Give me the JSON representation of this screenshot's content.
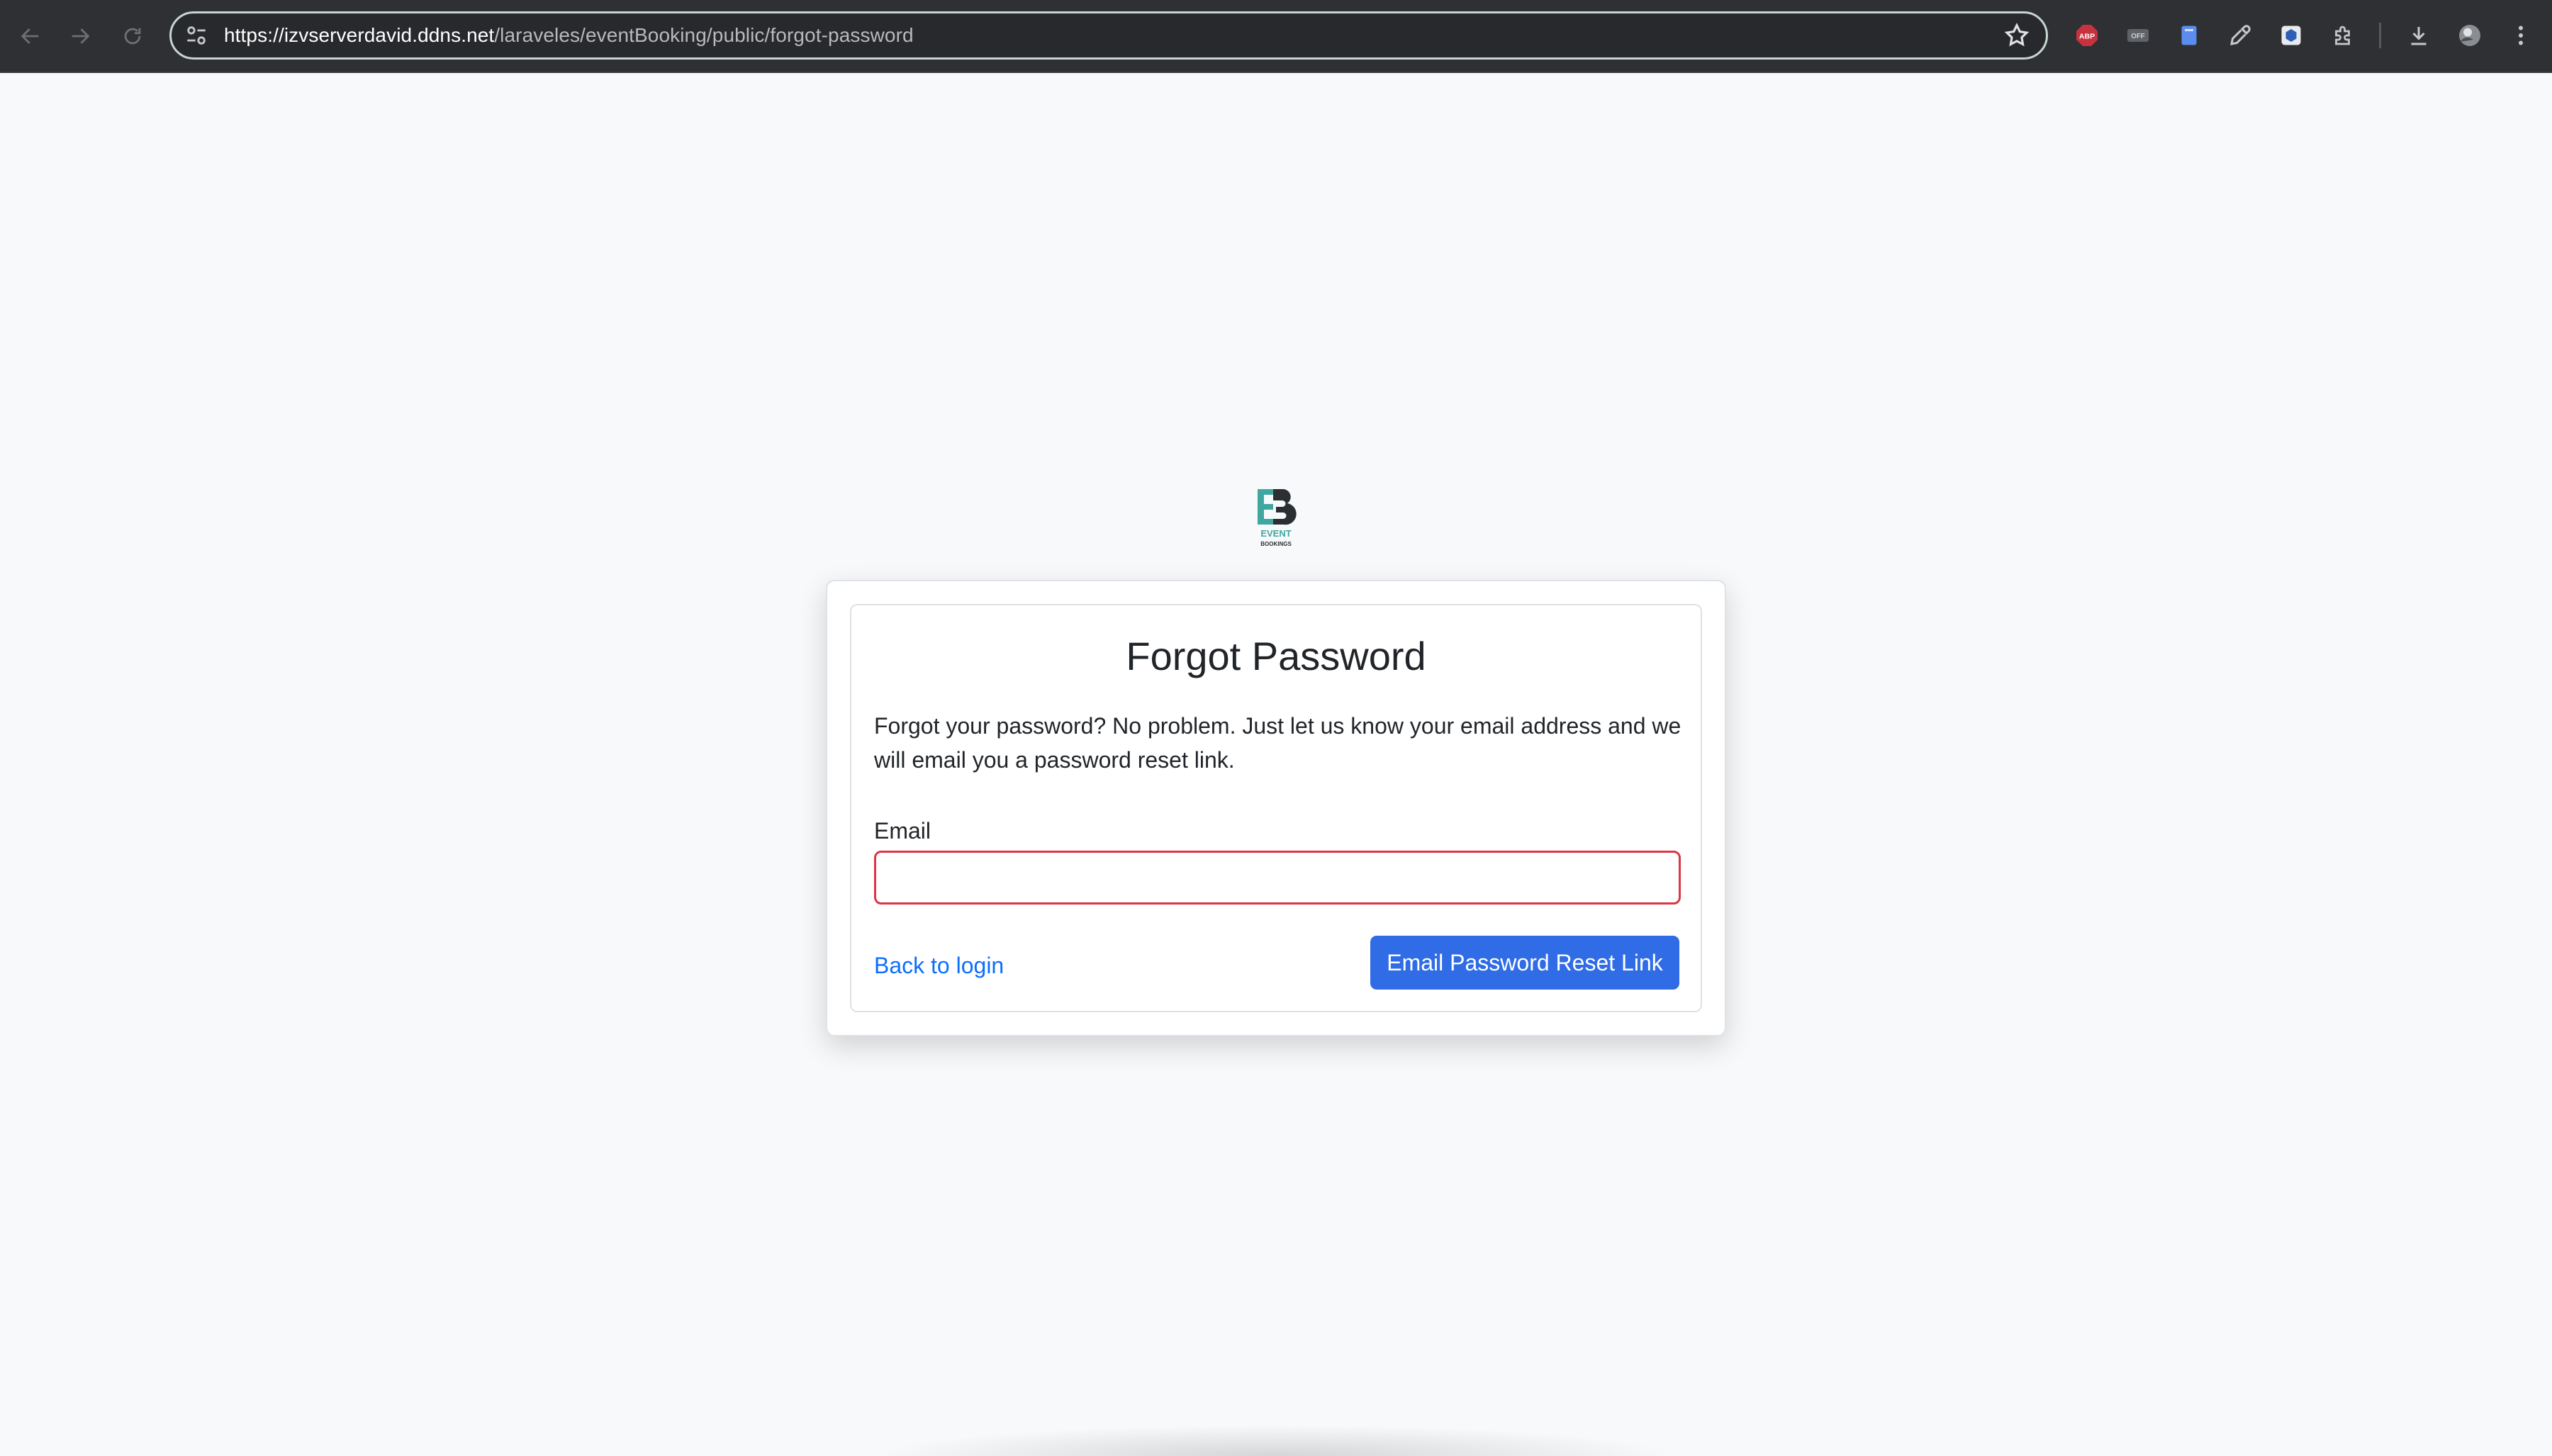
{
  "browser": {
    "url_host": "https://izvserverdavid.ddns.net",
    "url_path": "/laraveles/eventBooking/public/forgot-password",
    "nav_icons": [
      "back-arrow-icon",
      "forward-arrow-icon",
      "reload-icon"
    ],
    "extension_icons": [
      "adblock-icon",
      "off-toggle-extension-icon",
      "notes-extension-icon",
      "eyedropper-icon",
      "box-extension-icon",
      "puzzle-extensions-icon",
      "download-icon",
      "profile-avatar-icon",
      "kebab-menu-icon"
    ],
    "ext_labels": {
      "adblock": "ABP",
      "off": "OFF"
    }
  },
  "logo": {
    "letters": "EB",
    "line1": "EVENT",
    "line2": "BOOKINGS",
    "colors": {
      "teal": "#3fa6a0",
      "dark": "#2b2f33"
    }
  },
  "form": {
    "title": "Forgot Password",
    "description": "Forgot your password? No problem. Just let us know your email address and we will email you a password reset link.",
    "email_label": "Email",
    "email_value": "",
    "back_link": "Back to login",
    "submit_label": "Email Password Reset Link"
  },
  "colors": {
    "primary": "#2f6ce5",
    "link": "#0d6efd",
    "error_border": "#dc3545",
    "page_bg": "#f8f9fa"
  }
}
